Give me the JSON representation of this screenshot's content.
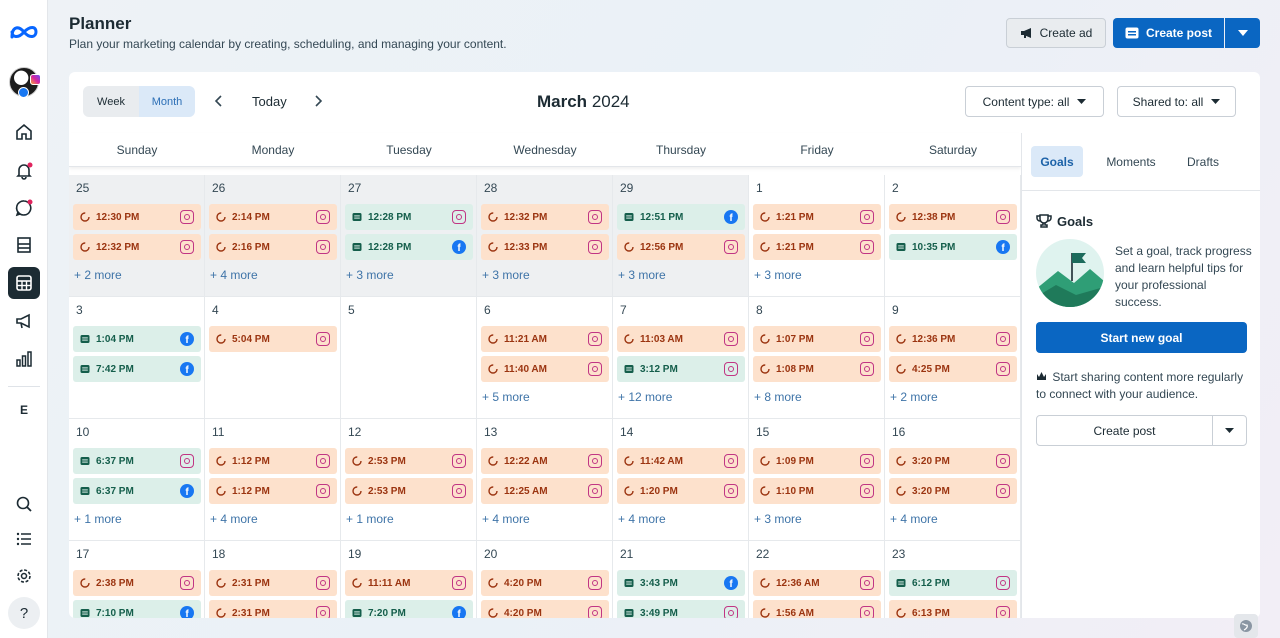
{
  "header": {
    "title": "Planner",
    "subtitle": "Plan your marketing calendar by creating, scheduling, and managing your content.",
    "create_ad": "Create ad",
    "create_post": "Create post"
  },
  "rail": {
    "workspace_letter": "E",
    "icons": [
      "meta-logo-icon",
      "home-icon",
      "notifications-icon",
      "inbox-icon",
      "content-icon",
      "planner-icon",
      "ads-icon",
      "insights-icon",
      "search-icon",
      "menu-list-icon",
      "settings-icon",
      "help-icon"
    ]
  },
  "toolbar": {
    "week": "Week",
    "month": "Month",
    "today": "Today",
    "month_name": "March",
    "year": "2024",
    "content_type": "Content type: all",
    "shared_to": "Shared to: all"
  },
  "daynames": [
    "Sunday",
    "Monday",
    "Tuesday",
    "Wednesday",
    "Thursday",
    "Friday",
    "Saturday"
  ],
  "colors": {
    "accent": "#0a66c2",
    "scheduled_bg": "#fde1cc",
    "published_bg": "#dcefe9",
    "more_link": "#3f74a8"
  },
  "weeks": [
    [
      {
        "day": "25",
        "outside": true,
        "posts": [
          {
            "time": "12:30 PM",
            "status": "scheduled",
            "platform": "instagram"
          },
          {
            "time": "12:32 PM",
            "status": "scheduled",
            "platform": "instagram"
          }
        ],
        "more": "+ 2 more"
      },
      {
        "day": "26",
        "outside": true,
        "posts": [
          {
            "time": "2:14 PM",
            "status": "scheduled",
            "platform": "instagram"
          },
          {
            "time": "2:16 PM",
            "status": "scheduled",
            "platform": "instagram"
          }
        ],
        "more": "+ 4 more"
      },
      {
        "day": "27",
        "outside": true,
        "posts": [
          {
            "time": "12:28 PM",
            "status": "published",
            "platform": "instagram"
          },
          {
            "time": "12:28 PM",
            "status": "published",
            "platform": "facebook"
          }
        ],
        "more": "+ 3 more"
      },
      {
        "day": "28",
        "outside": true,
        "posts": [
          {
            "time": "12:32 PM",
            "status": "scheduled",
            "platform": "instagram"
          },
          {
            "time": "12:33 PM",
            "status": "scheduled",
            "platform": "instagram"
          }
        ],
        "more": "+ 3 more"
      },
      {
        "day": "29",
        "outside": true,
        "posts": [
          {
            "time": "12:51 PM",
            "status": "published",
            "platform": "facebook"
          },
          {
            "time": "12:56 PM",
            "status": "scheduled",
            "platform": "instagram"
          }
        ],
        "more": "+ 3 more"
      },
      {
        "day": "1",
        "outside": false,
        "posts": [
          {
            "time": "1:21 PM",
            "status": "scheduled",
            "platform": "instagram"
          },
          {
            "time": "1:21 PM",
            "status": "scheduled",
            "platform": "instagram"
          }
        ],
        "more": "+ 3 more"
      },
      {
        "day": "2",
        "outside": false,
        "posts": [
          {
            "time": "12:38 PM",
            "status": "scheduled",
            "platform": "instagram"
          },
          {
            "time": "10:35 PM",
            "status": "published",
            "platform": "facebook"
          }
        ],
        "more": ""
      }
    ],
    [
      {
        "day": "3",
        "outside": false,
        "posts": [
          {
            "time": "1:04 PM",
            "status": "published",
            "platform": "facebook"
          },
          {
            "time": "7:42 PM",
            "status": "published",
            "platform": "facebook"
          }
        ],
        "more": ""
      },
      {
        "day": "4",
        "outside": false,
        "posts": [
          {
            "time": "5:04 PM",
            "status": "scheduled",
            "platform": "instagram"
          }
        ],
        "more": ""
      },
      {
        "day": "5",
        "outside": false,
        "posts": [],
        "more": ""
      },
      {
        "day": "6",
        "outside": false,
        "posts": [
          {
            "time": "11:21 AM",
            "status": "scheduled",
            "platform": "instagram"
          },
          {
            "time": "11:40 AM",
            "status": "scheduled",
            "platform": "instagram"
          }
        ],
        "more": "+ 5 more"
      },
      {
        "day": "7",
        "outside": false,
        "posts": [
          {
            "time": "11:03 AM",
            "status": "scheduled",
            "platform": "instagram"
          },
          {
            "time": "3:12 PM",
            "status": "published",
            "platform": "instagram"
          }
        ],
        "more": "+ 12 more"
      },
      {
        "day": "8",
        "outside": false,
        "posts": [
          {
            "time": "1:07 PM",
            "status": "scheduled",
            "platform": "instagram"
          },
          {
            "time": "1:08 PM",
            "status": "scheduled",
            "platform": "instagram"
          }
        ],
        "more": "+ 8 more"
      },
      {
        "day": "9",
        "outside": false,
        "posts": [
          {
            "time": "12:36 PM",
            "status": "scheduled",
            "platform": "instagram"
          },
          {
            "time": "4:25 PM",
            "status": "scheduled",
            "platform": "instagram"
          }
        ],
        "more": "+ 2 more"
      }
    ],
    [
      {
        "day": "10",
        "outside": false,
        "posts": [
          {
            "time": "6:37 PM",
            "status": "published",
            "platform": "instagram"
          },
          {
            "time": "6:37 PM",
            "status": "published",
            "platform": "facebook"
          }
        ],
        "more": "+ 1 more"
      },
      {
        "day": "11",
        "outside": false,
        "posts": [
          {
            "time": "1:12 PM",
            "status": "scheduled",
            "platform": "instagram"
          },
          {
            "time": "1:12 PM",
            "status": "scheduled",
            "platform": "instagram"
          }
        ],
        "more": "+ 4 more"
      },
      {
        "day": "12",
        "outside": false,
        "posts": [
          {
            "time": "2:53 PM",
            "status": "scheduled",
            "platform": "instagram"
          },
          {
            "time": "2:53 PM",
            "status": "scheduled",
            "platform": "instagram"
          }
        ],
        "more": "+ 1 more"
      },
      {
        "day": "13",
        "outside": false,
        "posts": [
          {
            "time": "12:22 AM",
            "status": "scheduled",
            "platform": "instagram"
          },
          {
            "time": "12:25 AM",
            "status": "scheduled",
            "platform": "instagram"
          }
        ],
        "more": "+ 4 more"
      },
      {
        "day": "14",
        "outside": false,
        "posts": [
          {
            "time": "11:42 AM",
            "status": "scheduled",
            "platform": "instagram"
          },
          {
            "time": "1:20 PM",
            "status": "scheduled",
            "platform": "instagram"
          }
        ],
        "more": "+ 4 more"
      },
      {
        "day": "15",
        "outside": false,
        "posts": [
          {
            "time": "1:09 PM",
            "status": "scheduled",
            "platform": "instagram"
          },
          {
            "time": "1:10 PM",
            "status": "scheduled",
            "platform": "instagram"
          }
        ],
        "more": "+ 3 more"
      },
      {
        "day": "16",
        "outside": false,
        "posts": [
          {
            "time": "3:20 PM",
            "status": "scheduled",
            "platform": "instagram"
          },
          {
            "time": "3:20 PM",
            "status": "scheduled",
            "platform": "instagram"
          }
        ],
        "more": "+ 4 more"
      }
    ],
    [
      {
        "day": "17",
        "outside": false,
        "posts": [
          {
            "time": "2:38 PM",
            "status": "scheduled",
            "platform": "instagram"
          },
          {
            "time": "7:10 PM",
            "status": "published",
            "platform": "facebook"
          }
        ],
        "more": ""
      },
      {
        "day": "18",
        "outside": false,
        "posts": [
          {
            "time": "2:31 PM",
            "status": "scheduled",
            "platform": "instagram"
          },
          {
            "time": "2:31 PM",
            "status": "scheduled",
            "platform": "instagram"
          }
        ],
        "more": ""
      },
      {
        "day": "19",
        "outside": false,
        "posts": [
          {
            "time": "11:11 AM",
            "status": "scheduled",
            "platform": "instagram"
          },
          {
            "time": "7:20 PM",
            "status": "published",
            "platform": "facebook"
          }
        ],
        "more": ""
      },
      {
        "day": "20",
        "outside": false,
        "posts": [
          {
            "time": "4:20 PM",
            "status": "scheduled",
            "platform": "instagram"
          },
          {
            "time": "4:20 PM",
            "status": "scheduled",
            "platform": "instagram"
          }
        ],
        "more": ""
      },
      {
        "day": "21",
        "outside": false,
        "posts": [
          {
            "time": "3:43 PM",
            "status": "published",
            "platform": "facebook"
          },
          {
            "time": "3:49 PM",
            "status": "published",
            "platform": "instagram"
          }
        ],
        "more": ""
      },
      {
        "day": "22",
        "outside": false,
        "posts": [
          {
            "time": "12:36 AM",
            "status": "scheduled",
            "platform": "instagram"
          },
          {
            "time": "1:56 AM",
            "status": "scheduled",
            "platform": "instagram"
          }
        ],
        "more": ""
      },
      {
        "day": "23",
        "outside": false,
        "posts": [
          {
            "time": "6:12 PM",
            "status": "published",
            "platform": "instagram"
          },
          {
            "time": "6:13 PM",
            "status": "scheduled",
            "platform": "instagram"
          }
        ],
        "more": ""
      }
    ]
  ],
  "side": {
    "tabs": [
      "Goals",
      "Moments",
      "Drafts"
    ],
    "goals_heading": "Goals",
    "goals_text": "Set a goal, track progress and learn helpful tips for your professional success.",
    "start_goal": "Start new goal",
    "share_tip": "Start sharing content more regularly to connect with your audience.",
    "create_post": "Create post"
  }
}
